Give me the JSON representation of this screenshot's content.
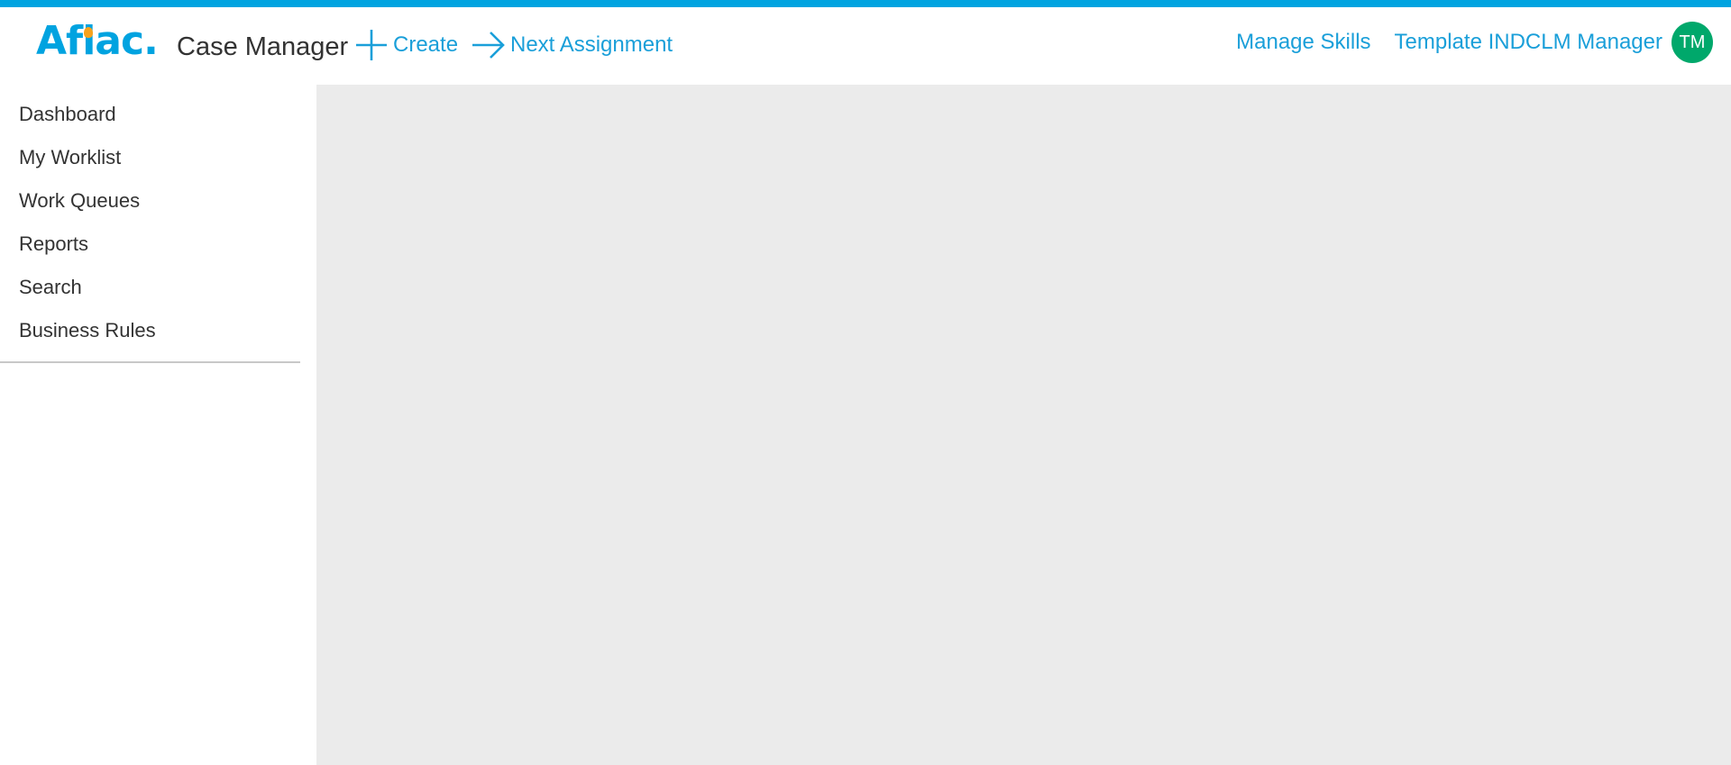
{
  "header": {
    "logo_text": "Aflac.",
    "app_title": "Case Manager",
    "create_label": "Create",
    "next_assignment_label": "Next Assignment",
    "manage_skills_label": "Manage Skills",
    "user_name": "Template INDCLM Manager",
    "avatar_initials": "TM"
  },
  "sidebar": {
    "items": [
      {
        "label": "Dashboard"
      },
      {
        "label": "My Worklist"
      },
      {
        "label": "Work Queues"
      },
      {
        "label": "Reports"
      },
      {
        "label": "Search"
      },
      {
        "label": "Business Rules"
      }
    ]
  },
  "colors": {
    "brand_blue": "#00a3e0",
    "link_blue": "#1a9fd9",
    "avatar_green": "#00a86b",
    "content_bg": "#ebebeb"
  },
  "icons": {
    "create": "plus-icon",
    "next_assignment": "arrow-right-icon"
  }
}
